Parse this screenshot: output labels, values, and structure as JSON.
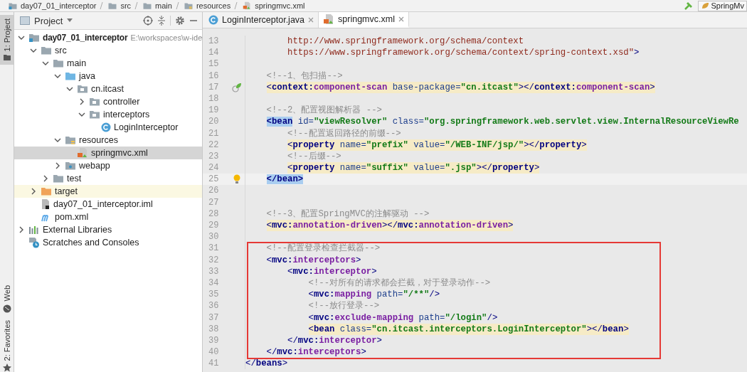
{
  "breadcrumbs": [
    {
      "label": "day07_01_interceptor",
      "kind": "module"
    },
    {
      "label": "src",
      "kind": "folder"
    },
    {
      "label": "main",
      "kind": "folder"
    },
    {
      "label": "resources",
      "kind": "resources"
    },
    {
      "label": "springmvc.xml",
      "kind": "xml"
    }
  ],
  "run_config": {
    "label": "SpringMv"
  },
  "tool_tabs": [
    {
      "label": "1: Project",
      "kind": "project",
      "selected": true
    },
    {
      "label": "Web",
      "kind": "web",
      "selected": false
    },
    {
      "label": "2: Favorites",
      "kind": "favorites",
      "selected": false
    }
  ],
  "project_panel": {
    "title": "Project",
    "tree": [
      {
        "label": "day07_01_interceptor",
        "path": "E:\\workspaces\\w-ide",
        "kind": "module",
        "expanded": true,
        "selected": false,
        "excluded": false,
        "children": [
          {
            "label": "src",
            "kind": "folder",
            "expanded": true,
            "selected": false,
            "excluded": false,
            "children": [
              {
                "label": "main",
                "kind": "folder",
                "expanded": true,
                "selected": false,
                "excluded": false,
                "children": [
                  {
                    "label": "java",
                    "kind": "source",
                    "expanded": true,
                    "selected": false,
                    "excluded": false,
                    "children": [
                      {
                        "label": "cn.itcast",
                        "kind": "package",
                        "expanded": true,
                        "selected": false,
                        "excluded": false,
                        "children": [
                          {
                            "label": "controller",
                            "kind": "package",
                            "expanded": false,
                            "selected": false,
                            "excluded": false
                          },
                          {
                            "label": "interceptors",
                            "kind": "package",
                            "expanded": true,
                            "selected": false,
                            "excluded": false,
                            "children": [
                              {
                                "label": "LoginInterceptor",
                                "kind": "class",
                                "selected": false,
                                "excluded": false
                              }
                            ]
                          }
                        ]
                      }
                    ]
                  },
                  {
                    "label": "resources",
                    "kind": "resources",
                    "expanded": true,
                    "selected": false,
                    "excluded": false,
                    "children": [
                      {
                        "label": "springmvc.xml",
                        "kind": "xml",
                        "selected": true,
                        "excluded": false
                      }
                    ]
                  },
                  {
                    "label": "webapp",
                    "kind": "web",
                    "expanded": false,
                    "selected": false,
                    "excluded": false
                  }
                ]
              },
              {
                "label": "test",
                "kind": "folder",
                "expanded": false,
                "selected": false,
                "excluded": false
              }
            ]
          },
          {
            "label": "target",
            "kind": "excluded",
            "expanded": false,
            "selected": false,
            "excluded": true
          },
          {
            "label": "day07_01_interceptor.iml",
            "kind": "iml",
            "selected": false,
            "excluded": false
          },
          {
            "label": "pom.xml",
            "kind": "maven",
            "selected": false,
            "excluded": false
          }
        ]
      },
      {
        "label": "External Libraries",
        "kind": "libraries",
        "expanded": false,
        "selected": false,
        "excluded": false
      },
      {
        "label": "Scratches and Consoles",
        "kind": "scratches",
        "selected": false,
        "excluded": false
      }
    ]
  },
  "editor_tabs": [
    {
      "label": "LoginInterceptor.java",
      "kind": "class",
      "selected": false
    },
    {
      "label": "springmvc.xml",
      "kind": "xml",
      "selected": true
    }
  ],
  "code_lines": [
    {
      "kind": "line",
      "number": "13",
      "highlighted": false,
      "current": false,
      "segments": [
        {
          "kind": "string",
          "text": "        http://www.springframework.org/schema/context"
        }
      ]
    },
    {
      "kind": "line",
      "number": "14",
      "highlighted": false,
      "current": false,
      "segments": [
        {
          "kind": "string",
          "text": "        https://www.springframework.org/schema/context/spring-context.xsd\""
        },
        {
          "kind": "bracket",
          "text": ">"
        }
      ]
    },
    {
      "kind": "line",
      "number": "15",
      "highlighted": false,
      "current": false
    },
    {
      "kind": "line",
      "number": "16",
      "highlighted": false,
      "current": false,
      "segments": [
        {
          "kind": "comment",
          "text": "    <!--1、包扫描-->"
        }
      ]
    },
    {
      "kind": "line",
      "number": "17",
      "highlighted": true,
      "current": false,
      "segments": [
        {
          "kind": "bracket",
          "text": "    <"
        },
        {
          "kind": "ns",
          "text": "context:"
        },
        {
          "kind": "name",
          "text": "component-scan"
        },
        {
          "kind": "attr",
          "text": " base-package="
        },
        {
          "kind": "value",
          "text": "\"cn.itcast\""
        },
        {
          "kind": "bracket",
          "text": "></"
        },
        {
          "kind": "ns",
          "text": "context:"
        },
        {
          "kind": "name",
          "text": "component-scan"
        },
        {
          "kind": "bracket",
          "text": ">"
        }
      ]
    },
    {
      "kind": "line",
      "number": "18",
      "highlighted": false,
      "current": false
    },
    {
      "kind": "line",
      "number": "19",
      "highlighted": false,
      "current": false,
      "segments": [
        {
          "kind": "comment",
          "text": "    <!--2、配置视图解析器 -->"
        }
      ]
    },
    {
      "kind": "line",
      "number": "20",
      "highlighted": false,
      "current": false,
      "segments": [
        {
          "kind": "match",
          "text": "    <bean"
        },
        {
          "kind": "attr",
          "text": " id="
        },
        {
          "kind": "value",
          "text": "\"viewResolver\""
        },
        {
          "kind": "attr",
          "text": " class="
        },
        {
          "kind": "value",
          "text": "\"org.springframework.web.servlet.view.InternalResourceViewRe"
        }
      ]
    },
    {
      "kind": "line",
      "number": "21",
      "highlighted": false,
      "current": false,
      "segments": [
        {
          "kind": "comment",
          "text": "        <!--配置返回路径的前缀-->"
        }
      ]
    },
    {
      "kind": "line",
      "number": "22",
      "highlighted": true,
      "current": false,
      "segments": [
        {
          "kind": "bracket",
          "text": "        <"
        },
        {
          "kind": "tag",
          "text": "property"
        },
        {
          "kind": "attr",
          "text": " name="
        },
        {
          "kind": "value",
          "text": "\"prefix\""
        },
        {
          "kind": "attr",
          "text": " value="
        },
        {
          "kind": "value",
          "text": "\"/WEB-INF/jsp/\""
        },
        {
          "kind": "bracket",
          "text": "></"
        },
        {
          "kind": "tag",
          "text": "property"
        },
        {
          "kind": "bracket",
          "text": ">"
        }
      ]
    },
    {
      "kind": "line",
      "number": "23",
      "highlighted": false,
      "current": false,
      "segments": [
        {
          "kind": "comment",
          "text": "        <!--后缀-->"
        }
      ]
    },
    {
      "kind": "line",
      "number": "24",
      "highlighted": true,
      "current": false,
      "segments": [
        {
          "kind": "bracket",
          "text": "        <"
        },
        {
          "kind": "tag",
          "text": "property"
        },
        {
          "kind": "attr",
          "text": " name="
        },
        {
          "kind": "value",
          "text": "\"suffix\""
        },
        {
          "kind": "attr",
          "text": " value="
        },
        {
          "kind": "value",
          "text": "\".jsp\""
        },
        {
          "kind": "bracket",
          "text": "></"
        },
        {
          "kind": "tag",
          "text": "property"
        },
        {
          "kind": "bracket",
          "text": ">"
        }
      ]
    },
    {
      "kind": "line",
      "number": "25",
      "highlighted": false,
      "current": true,
      "segments": [
        {
          "kind": "match",
          "text": "    </bean>"
        }
      ]
    },
    {
      "kind": "line",
      "number": "26",
      "highlighted": false,
      "current": false
    },
    {
      "kind": "line",
      "number": "27",
      "highlighted": false,
      "current": false
    },
    {
      "kind": "line",
      "number": "28",
      "highlighted": false,
      "current": false,
      "segments": [
        {
          "kind": "comment",
          "text": "    <!--3、配置SpringMVC的注解驱动 -->"
        }
      ]
    },
    {
      "kind": "line",
      "number": "29",
      "highlighted": true,
      "current": false,
      "segments": [
        {
          "kind": "bracket",
          "text": "    <"
        },
        {
          "kind": "ns",
          "text": "mvc:"
        },
        {
          "kind": "name",
          "text": "annotation-driven"
        },
        {
          "kind": "bracket",
          "text": "></"
        },
        {
          "kind": "ns",
          "text": "mvc:"
        },
        {
          "kind": "name",
          "text": "annotation-driven"
        },
        {
          "kind": "bracket",
          "text": ">"
        }
      ]
    },
    {
      "kind": "line",
      "number": "30",
      "highlighted": false,
      "current": false
    },
    {
      "kind": "boxed",
      "lines": [
        {
          "kind": "line",
          "number": "31",
          "highlighted": false,
          "current": false,
          "segments": [
            {
              "kind": "comment",
              "text": "    <!--配置登录检查拦截器-->"
            }
          ]
        },
        {
          "kind": "line",
          "number": "32",
          "highlighted": false,
          "current": false,
          "segments": [
            {
              "kind": "bracket",
              "text": "    <"
            },
            {
              "kind": "ns",
              "text": "mvc:"
            },
            {
              "kind": "name",
              "text": "interceptors"
            },
            {
              "kind": "bracket",
              "text": ">"
            }
          ]
        },
        {
          "kind": "line",
          "number": "33",
          "highlighted": false,
          "current": false,
          "segments": [
            {
              "kind": "bracket",
              "text": "        <"
            },
            {
              "kind": "ns",
              "text": "mvc:"
            },
            {
              "kind": "name",
              "text": "interceptor"
            },
            {
              "kind": "bracket",
              "text": ">"
            }
          ]
        },
        {
          "kind": "line",
          "number": "34",
          "highlighted": false,
          "current": false,
          "segments": [
            {
              "kind": "comment",
              "text": "            <!--对所有的请求都会拦截，对于登录动作-->"
            }
          ]
        },
        {
          "kind": "line",
          "number": "35",
          "highlighted": false,
          "current": false,
          "segments": [
            {
              "kind": "bracket",
              "text": "            <"
            },
            {
              "kind": "ns",
              "text": "mvc:"
            },
            {
              "kind": "name",
              "text": "mapping"
            },
            {
              "kind": "attr",
              "text": " path="
            },
            {
              "kind": "value",
              "text": "\"/**\""
            },
            {
              "kind": "bracket",
              "text": "/>"
            }
          ]
        },
        {
          "kind": "line",
          "number": "36",
          "highlighted": false,
          "current": false,
          "segments": [
            {
              "kind": "comment",
              "text": "            <!--放行登录-->"
            }
          ]
        },
        {
          "kind": "line",
          "number": "37",
          "highlighted": false,
          "current": false,
          "segments": [
            {
              "kind": "bracket",
              "text": "            <"
            },
            {
              "kind": "ns",
              "text": "mvc:"
            },
            {
              "kind": "name",
              "text": "exclude-mapping"
            },
            {
              "kind": "attr",
              "text": " path="
            },
            {
              "kind": "value",
              "text": "\"/login\""
            },
            {
              "kind": "bracket",
              "text": "/>"
            }
          ]
        },
        {
          "kind": "line",
          "number": "38",
          "highlighted": true,
          "current": false,
          "segments": [
            {
              "kind": "bracket",
              "text": "            <"
            },
            {
              "kind": "tag",
              "text": "bean"
            },
            {
              "kind": "attr",
              "text": " class="
            },
            {
              "kind": "value",
              "text": "\"cn.itcast.interceptors.LoginInterceptor\""
            },
            {
              "kind": "bracket",
              "text": "></"
            },
            {
              "kind": "tag",
              "text": "bean"
            },
            {
              "kind": "bracket",
              "text": ">"
            }
          ]
        },
        {
          "kind": "line",
          "number": "39",
          "highlighted": false,
          "current": false,
          "segments": [
            {
              "kind": "bracket",
              "text": "        </"
            },
            {
              "kind": "ns",
              "text": "mvc:"
            },
            {
              "kind": "name",
              "text": "interceptor"
            },
            {
              "kind": "bracket",
              "text": ">"
            }
          ]
        },
        {
          "kind": "line",
          "number": "40",
          "highlighted": false,
          "current": false,
          "segments": [
            {
              "kind": "bracket",
              "text": "    </"
            },
            {
              "kind": "ns",
              "text": "mvc:"
            },
            {
              "kind": "name",
              "text": "interceptors"
            },
            {
              "kind": "bracket",
              "text": ">"
            }
          ]
        }
      ]
    },
    {
      "kind": "line",
      "number": "41",
      "highlighted": false,
      "current": false,
      "segments": [
        {
          "kind": "bracket",
          "text": "</"
        },
        {
          "kind": "tag",
          "text": "beans"
        },
        {
          "kind": "bracket",
          "text": ">"
        }
      ]
    }
  ]
}
